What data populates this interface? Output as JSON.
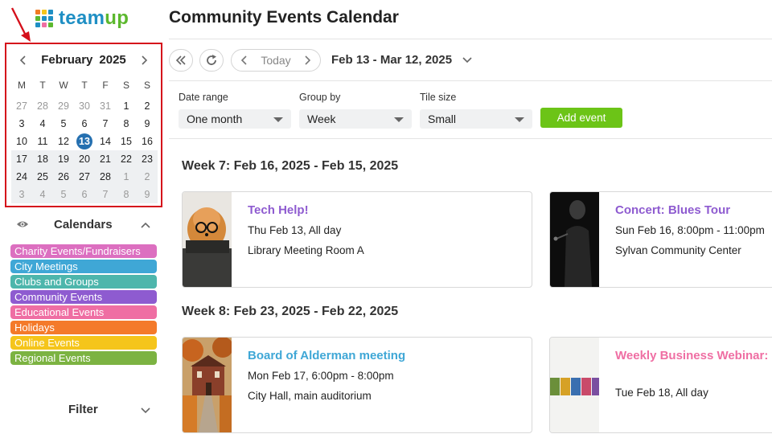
{
  "logo": {
    "text_a": "team",
    "text_b": "up"
  },
  "header": {
    "title": "Community Events Calendar"
  },
  "minical": {
    "month": "February",
    "year": "2025",
    "weekdays": [
      "M",
      "T",
      "W",
      "T",
      "F",
      "S",
      "S"
    ],
    "weeks": [
      [
        {
          "d": "27",
          "o": true
        },
        {
          "d": "28",
          "o": true
        },
        {
          "d": "29",
          "o": true
        },
        {
          "d": "30",
          "o": true
        },
        {
          "d": "31",
          "o": true
        },
        {
          "d": "1"
        },
        {
          "d": "2"
        }
      ],
      [
        {
          "d": "3"
        },
        {
          "d": "4"
        },
        {
          "d": "5"
        },
        {
          "d": "6"
        },
        {
          "d": "7"
        },
        {
          "d": "8"
        },
        {
          "d": "9"
        }
      ],
      [
        {
          "d": "10"
        },
        {
          "d": "11"
        },
        {
          "d": "12"
        },
        {
          "d": "13",
          "t": true
        },
        {
          "d": "14"
        },
        {
          "d": "15"
        },
        {
          "d": "16"
        }
      ],
      [
        {
          "d": "17"
        },
        {
          "d": "18"
        },
        {
          "d": "19"
        },
        {
          "d": "20"
        },
        {
          "d": "21"
        },
        {
          "d": "22"
        },
        {
          "d": "23"
        }
      ],
      [
        {
          "d": "24"
        },
        {
          "d": "25"
        },
        {
          "d": "26"
        },
        {
          "d": "27"
        },
        {
          "d": "28"
        },
        {
          "d": "1",
          "o": true
        },
        {
          "d": "2",
          "o": true
        }
      ],
      [
        {
          "d": "3",
          "o": true
        },
        {
          "d": "4",
          "o": true
        },
        {
          "d": "5",
          "o": true
        },
        {
          "d": "6",
          "o": true
        },
        {
          "d": "7",
          "o": true
        },
        {
          "d": "8",
          "o": true
        },
        {
          "d": "9",
          "o": true
        }
      ]
    ]
  },
  "calendars": {
    "title": "Calendars",
    "items": [
      {
        "label": "Charity Events/Fundraisers",
        "color": "#dc6fc0"
      },
      {
        "label": "City Meetings",
        "color": "#3fa7d6"
      },
      {
        "label": "Clubs and Groups",
        "color": "#4db6ac"
      },
      {
        "label": "Community Events",
        "color": "#8e5bd0"
      },
      {
        "label": "Educational Events",
        "color": "#ef6ea3"
      },
      {
        "label": "Holidays",
        "color": "#f47a2a"
      },
      {
        "label": "Online Events",
        "color": "#f5c51b"
      },
      {
        "label": "Regional Events",
        "color": "#7cb342"
      }
    ]
  },
  "filter": {
    "title": "Filter"
  },
  "toolbar": {
    "today_label": "Today",
    "range_label": "Feb 13 - Mar 12, 2025"
  },
  "options": {
    "date_range": {
      "label": "Date range",
      "value": "One month"
    },
    "group_by": {
      "label": "Group by",
      "value": "Week"
    },
    "tile_size": {
      "label": "Tile size",
      "value": "Small"
    },
    "add_label": "Add event"
  },
  "weeks": [
    {
      "title": "Week 7: Feb 16, 2025 - Feb 15, 2025",
      "events": [
        {
          "title": "Tech Help!",
          "color": "#8e5bd0",
          "when": "Thu Feb 13, All day",
          "where": "Library Meeting Room A"
        },
        {
          "title": "Concert: Blues Tour",
          "color": "#8e5bd0",
          "when": "Sun Feb 16, 8:00pm - 11:00pm",
          "where": "Sylvan Community Center"
        }
      ]
    },
    {
      "title": "Week 8: Feb 23, 2025 - Feb 22, 2025",
      "events": [
        {
          "title": "Board of Alderman meeting",
          "color": "#3fa7d6",
          "when": "Mon Feb 17, 6:00pm - 8:00pm",
          "where": "City Hall, main auditorium"
        },
        {
          "title": "Weekly Business Webinar: I strategies",
          "color": "#ef6ea3",
          "when": "Tue Feb 18, All day",
          "where": ""
        }
      ]
    }
  ]
}
